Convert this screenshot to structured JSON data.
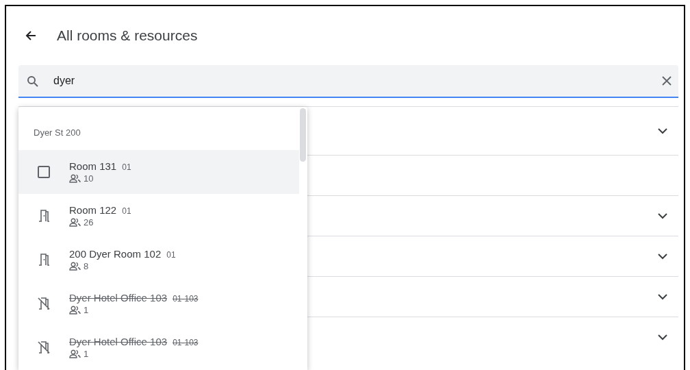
{
  "header": {
    "title": "All rooms & resources"
  },
  "search": {
    "value": "dyer",
    "focused": true
  },
  "result_rows": [
    {
      "expandable": true
    },
    {
      "expandable": false
    },
    {
      "expandable": true
    },
    {
      "expandable": true
    },
    {
      "expandable": true
    },
    {
      "expandable": true
    }
  ],
  "dropdown": {
    "group": "Dyer St 200",
    "items": [
      {
        "kind": "checkbox",
        "name": "Room 131",
        "code": "01",
        "capacity": "10",
        "struck": false,
        "selected": true
      },
      {
        "kind": "door",
        "name": "Room 122",
        "code": "01",
        "capacity": "26",
        "struck": false,
        "selected": false
      },
      {
        "kind": "door",
        "name": "200 Dyer Room 102",
        "code": "01",
        "capacity": "8",
        "struck": false,
        "selected": false
      },
      {
        "kind": "door-off",
        "name": "Dyer Hotel Office 103",
        "code": "01-103",
        "capacity": "1",
        "struck": true,
        "selected": false
      },
      {
        "kind": "door-off",
        "name": "Dyer Hotel Office 103",
        "code": "01-103",
        "capacity": "1",
        "struck": true,
        "selected": false
      }
    ]
  }
}
